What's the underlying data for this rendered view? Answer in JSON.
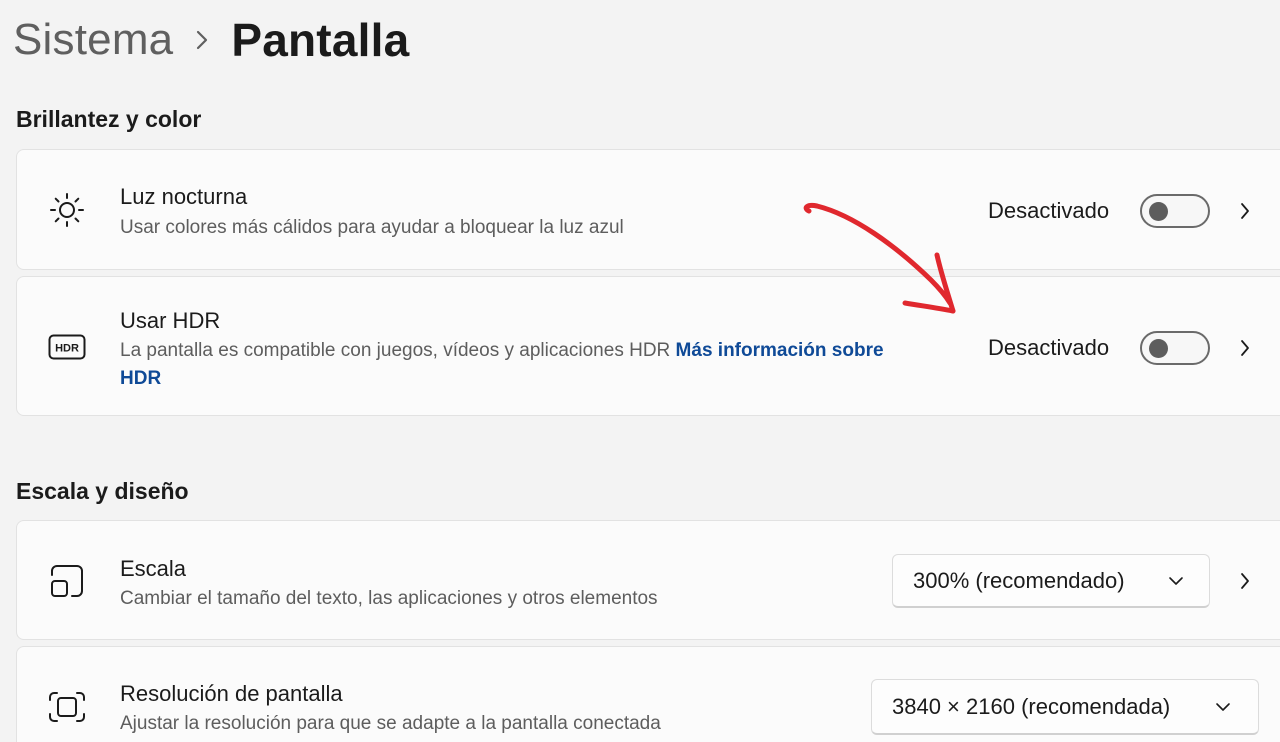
{
  "breadcrumb": {
    "parent": "Sistema",
    "current": "Pantalla"
  },
  "sections": {
    "brightness": {
      "title": "Brillantez y color",
      "night_light": {
        "title": "Luz nocturna",
        "description": "Usar colores más cálidos para ayudar a bloquear la luz azul",
        "state": "Desactivado"
      },
      "hdr": {
        "title": "Usar HDR",
        "description": "La pantalla es compatible con juegos, vídeos y aplicaciones HDR",
        "link": "Más información sobre HDR",
        "state": "Desactivado",
        "icon_text": "HDR"
      }
    },
    "scale_layout": {
      "title": "Escala y diseño",
      "scale": {
        "title": "Escala",
        "description": "Cambiar el tamaño del texto, las aplicaciones y otros elementos",
        "value": "300% (recomendado)"
      },
      "resolution": {
        "title": "Resolución de pantalla",
        "description": "Ajustar la resolución para que se adapte a la pantalla conectada",
        "value": "3840 × 2160 (recomendada)"
      }
    }
  },
  "icons": {
    "breadcrumb_separator": "chevron-right-icon",
    "night_light": "night-light-icon",
    "hdr": "hdr-icon",
    "scale": "scale-icon",
    "resolution": "resolution-icon",
    "row_chevron": "chevron-right-icon",
    "dropdown": "chevron-down-icon",
    "annotation": "red-arrow-annotation-icon"
  },
  "colors": {
    "background": "#f3f3f3",
    "card": "#fbfbfb",
    "link": "#0f4a97",
    "annotation": "#e0282e"
  }
}
